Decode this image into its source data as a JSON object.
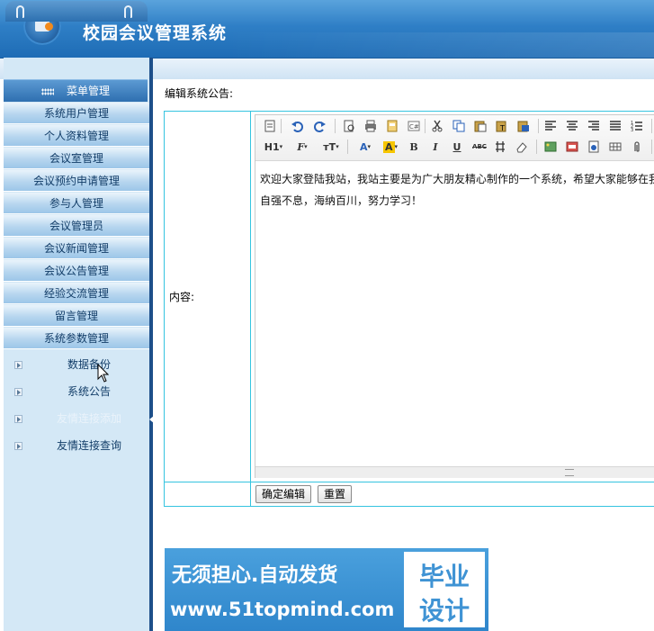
{
  "header": {
    "title": "校园会议管理系统"
  },
  "sidebar": {
    "menu_head": "菜单管理",
    "items": [
      {
        "label": "系统用户管理"
      },
      {
        "label": "个人资料管理"
      },
      {
        "label": "会议室管理"
      },
      {
        "label": "会议预约申请管理"
      },
      {
        "label": "参与人管理"
      },
      {
        "label": "会议管理员"
      },
      {
        "label": "会议新闻管理"
      },
      {
        "label": "会议公告管理"
      },
      {
        "label": "经验交流管理"
      },
      {
        "label": "留言管理"
      },
      {
        "label": "系统参数管理"
      }
    ],
    "sub_items": [
      {
        "label": "数据备份"
      },
      {
        "label": "系统公告"
      },
      {
        "label": "友情连接添加"
      },
      {
        "label": "友情连接查询"
      }
    ]
  },
  "main": {
    "page_label": "编辑系统公告:",
    "content_label": "内容:",
    "editor": {
      "line1": "欢迎大家登陆我站，我站主要是为广大朋友精心制作的一个系统，希望大家能够在我",
      "line2": "自强不息，海纳百川，努力学习！"
    },
    "toolbar": {
      "heading": "H1",
      "font": "F",
      "size": "тT",
      "font_color": "A",
      "bg_color": "A",
      "bold": "B",
      "italic": "I",
      "underline": "U",
      "strike": "ABC"
    },
    "buttons": {
      "submit": "确定编辑",
      "reset": "重置"
    }
  },
  "banner": {
    "line1": "无须担心.自动发货",
    "line2": "www.51topmind.com",
    "box_line1": "毕业",
    "box_line2": "设计"
  }
}
